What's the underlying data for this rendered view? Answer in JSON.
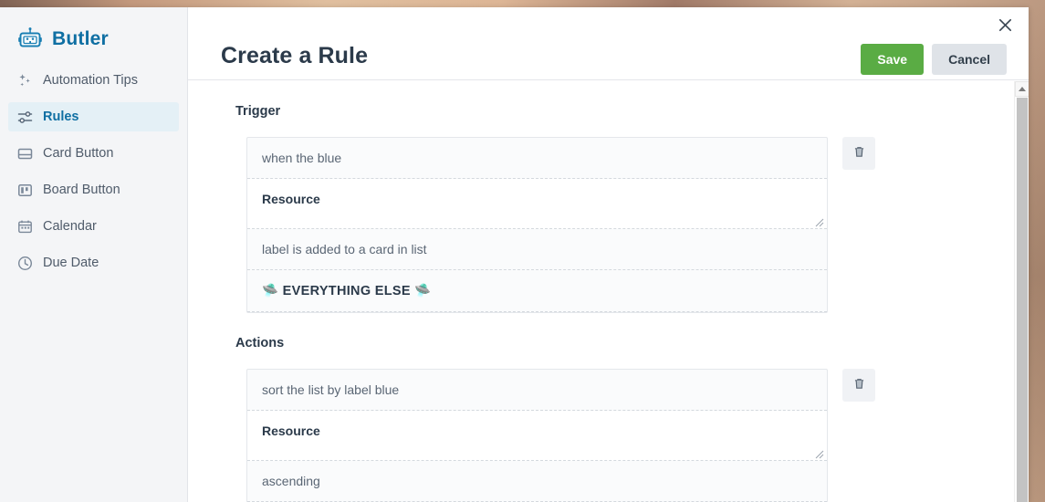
{
  "sidebar": {
    "brand": {
      "name": "Butler",
      "icon": "robot-icon"
    },
    "items": [
      {
        "label": "Automation Tips",
        "icon": "sparkles-icon",
        "active": false
      },
      {
        "label": "Rules",
        "icon": "sliders-icon",
        "active": true
      },
      {
        "label": "Card Button",
        "icon": "card-icon",
        "active": false
      },
      {
        "label": "Board Button",
        "icon": "board-icon",
        "active": false
      },
      {
        "label": "Calendar",
        "icon": "calendar-icon",
        "active": false
      },
      {
        "label": "Due Date",
        "icon": "clock-icon",
        "active": false
      }
    ]
  },
  "header": {
    "title": "Create a Rule",
    "save_label": "Save",
    "cancel_label": "Cancel",
    "close_icon": "close-icon"
  },
  "trigger": {
    "section_label": "Trigger",
    "lines": [
      {
        "text": "when the blue",
        "type": "text"
      },
      {
        "text": "Resource",
        "type": "resource"
      },
      {
        "text": "label is added to a card in list",
        "type": "text"
      },
      {
        "text": "🛸 EVERYTHING ELSE 🛸",
        "type": "emoji"
      }
    ],
    "delete_icon": "trash-icon"
  },
  "actions": {
    "section_label": "Actions",
    "lines": [
      {
        "text": "sort the list by label blue",
        "type": "text"
      },
      {
        "text": "Resource",
        "type": "resource"
      },
      {
        "text": "ascending",
        "type": "text"
      }
    ],
    "delete_icon": "trash-icon"
  },
  "scrollbar": {
    "up_arrow_icon": "caret-up-icon"
  },
  "colors": {
    "brand": "#0f6fa3",
    "save_green": "#5aac44",
    "cancel_grey": "#dfe3e8",
    "sidebar_bg": "#f4f5f7",
    "active_item_bg": "#e4f0f6",
    "accent_strip": "#efa66a"
  }
}
